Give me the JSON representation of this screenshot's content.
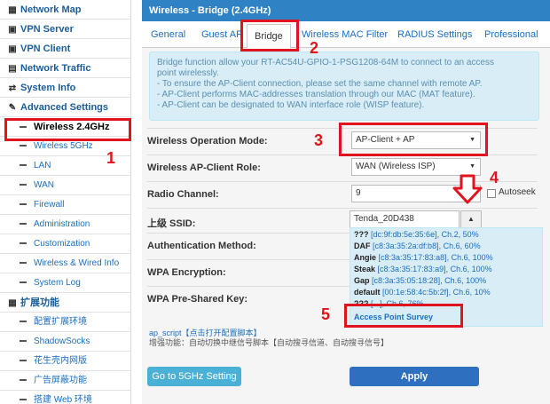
{
  "sidebar": {
    "top_items": [
      {
        "label": "Network Map",
        "icon": "map-icon"
      },
      {
        "label": "VPN Server",
        "icon": "lock-icon"
      },
      {
        "label": "VPN Client",
        "icon": "lock-icon"
      },
      {
        "label": "Network Traffic",
        "icon": "chart-icon"
      },
      {
        "label": "System Info",
        "icon": "shuffle-icon"
      },
      {
        "label": "Advanced Settings",
        "icon": "wrench-icon"
      }
    ],
    "sub_items": [
      {
        "label": "Wireless 2.4GHz",
        "active": true
      },
      {
        "label": "Wireless 5GHz"
      },
      {
        "label": "LAN"
      },
      {
        "label": "WAN"
      },
      {
        "label": "Firewall"
      },
      {
        "label": "Administration"
      },
      {
        "label": "Customization"
      },
      {
        "label": "Wireless & Wired Info"
      },
      {
        "label": "System Log"
      }
    ],
    "ext_header": "扩展功能",
    "ext_items": [
      {
        "label": "配置扩展环境"
      },
      {
        "label": "ShadowSocks"
      },
      {
        "label": "花生壳内网版"
      },
      {
        "label": "广告屏蔽功能"
      },
      {
        "label": "搭建 Web 环境"
      }
    ]
  },
  "panel": {
    "title": "Wireless - Bridge (2.4GHz)",
    "tabs": [
      "General",
      "Guest AP",
      "Bridge",
      "Wireless MAC Filter",
      "RADIUS Settings",
      "Professional"
    ],
    "active_tab": "Bridge",
    "info_lines": [
      "Bridge function allow your RT-AC54U-GPIO-1-PSG1208-64M to connect to an access",
      "point wirelessly.",
      "- To ensure the AP-Client connection, please set the same channel with remote AP.",
      "- AP-Client performs MAC-addresses translation through our MAC (MAT feature).",
      "- AP-Client can be designated to WAN interface role (WISP feature)."
    ],
    "fields": {
      "op_mode": {
        "label": "Wireless Operation Mode:",
        "value": "AP-Client + AP"
      },
      "client_role": {
        "label": "Wireless AP-Client Role:",
        "value": "WAN (Wireless ISP)"
      },
      "channel": {
        "label": "Radio Channel:",
        "value": "9",
        "autoseek": "Autoseek"
      },
      "ssid": {
        "label": "上级 SSID:",
        "value": "Tenda_20D438"
      },
      "auth": {
        "label": "Authentication Method:"
      },
      "wpa_enc": {
        "label": "WPA Encryption:"
      },
      "wpa_key": {
        "label": "WPA Pre-Shared Key:"
      }
    },
    "survey": [
      {
        "name": "???",
        "mac": "[dc:9f:db:5e:35:6e]",
        "info": ", Ch.2, 50%"
      },
      {
        "name": "DAF",
        "mac": "[c8:3a:35:2a:df:b8]",
        "info": ", Ch.6, 60%"
      },
      {
        "name": "Angie",
        "mac": "[c8:3a:35:17:83:a8]",
        "info": ", Ch.6, 100%"
      },
      {
        "name": "Steak",
        "mac": "[c8:3a:35:17:83:a9]",
        "info": ", Ch.6, 100%"
      },
      {
        "name": "Gap",
        "mac": "[c8:3a:35:05:18:28]",
        "info": ", Ch.6, 100%"
      },
      {
        "name": "default",
        "mac": "[00:1e:58:4c:5b:2f]",
        "info": ", Ch.6, 10%"
      },
      {
        "name": "???",
        "mac": "[...]",
        "info": ", Ch.6, 76%"
      }
    ],
    "survey_link": "Access Point Survey",
    "script_line1": "ap_script【点击打开配置脚本】",
    "script_line2": "增强功能：自动切换中继信号脚本【自动搜寻信道、自动搜寻信号】",
    "btn_5g": "Go to 5GHz Setting",
    "btn_apply": "Apply"
  },
  "annotations": [
    "1",
    "2",
    "3",
    "4",
    "5"
  ],
  "colors": {
    "accent": "#2f83c4",
    "annotation": "#e0141e",
    "info_bg": "#d9edf7"
  }
}
